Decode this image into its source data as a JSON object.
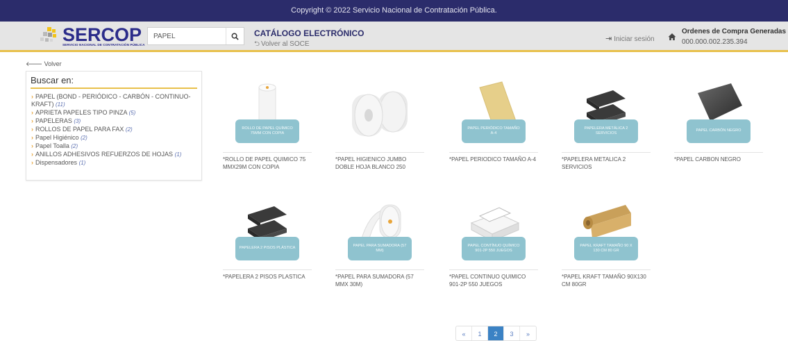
{
  "topbar": {
    "copyright": "Copyright © 2022 Servicio Nacional de Contratación Pública."
  },
  "header": {
    "logo_text": "SERCOP",
    "logo_sub": "SERVICIO NACIONAL DE CONTRATACIÓN PÚBLICA",
    "search_value": "PAPEL",
    "catalog_title": "CATÁLOGO ELECTRÓNICO",
    "back_to_soce": "Volver al SOCE",
    "login_label": "Iniciar sesión",
    "orders_title": "Ordenes de Compra Generadas",
    "orders_value": "000.000.002.235.394"
  },
  "volver_label": "Volver",
  "sidebar": {
    "title": "Buscar en:",
    "items": [
      {
        "label": "PAPEL (BOND - PERIÓDICO - CARBÓN - CONTINUO-KRAFT)",
        "count": "(11)"
      },
      {
        "label": "APRIETA PAPELES TIPO PINZA",
        "count": "(5)"
      },
      {
        "label": "PAPELERAS",
        "count": "(3)"
      },
      {
        "label": "ROLLOS DE PAPEL PARA FAX",
        "count": "(2)"
      },
      {
        "label": "Papel Higiénico",
        "count": "(2)"
      },
      {
        "label": "Papel Toalla",
        "count": "(2)"
      },
      {
        "label": "ANILLOS ADHESIVOS REFUERZOS DE HOJAS",
        "count": "(1)"
      },
      {
        "label": "Dispensadores",
        "count": "(1)"
      }
    ]
  },
  "products": [
    {
      "name": "*ROLLO DE PAPEL QUIMICO 75 MMX29M CON COPIA",
      "ribbon": "ROLLO DE PAPEL QUÍMICO 75MM CON COPIA"
    },
    {
      "name": "*PAPEL HIGIENICO JUMBO DOBLE HOJA BLANCO 250",
      "ribbon": ""
    },
    {
      "name": "*PAPEL PERIODICO TAMAÑO A-4",
      "ribbon": "PAPEL PERIÓDICO TAMAÑO A-4"
    },
    {
      "name": "*PAPELERA METALICA 2 SERVICIOS",
      "ribbon": "PAPELERA METÁLICA 2 SERVICIOS"
    },
    {
      "name": "*PAPEL CARBON NEGRO",
      "ribbon": "PAPEL CARBÓN NEGRO"
    },
    {
      "name": "*PAPELERA 2 PISOS PLASTICA",
      "ribbon": "PAPELERA 2 PISOS PLÁSTICA"
    },
    {
      "name": "*PAPEL PARA SUMADORA (57 MMX 30M)",
      "ribbon": "PAPEL PARA SUMADORA (57 MM)"
    },
    {
      "name": "*PAPEL CONTINUO QUIMICO 901-2P 550 JUEGOS",
      "ribbon": "PAPEL CONTÍNUO QUÍMICO 901-2P 550 JUEGOS"
    },
    {
      "name": "*PAPEL KRAFT TAMAÑO 90X130 CM 80GR",
      "ribbon": "PAPEL KRAFT TAMAÑO 90 X 130 CM 80 GR"
    }
  ],
  "pagination": {
    "prev": "«",
    "pages": [
      "1",
      "2",
      "3"
    ],
    "active": "2",
    "next": "»"
  },
  "colors": {
    "topbar": "#2b2c6b",
    "accent": "#e8c04a",
    "ribbon": "#8fc3cf",
    "active_page": "#3b82c4"
  }
}
